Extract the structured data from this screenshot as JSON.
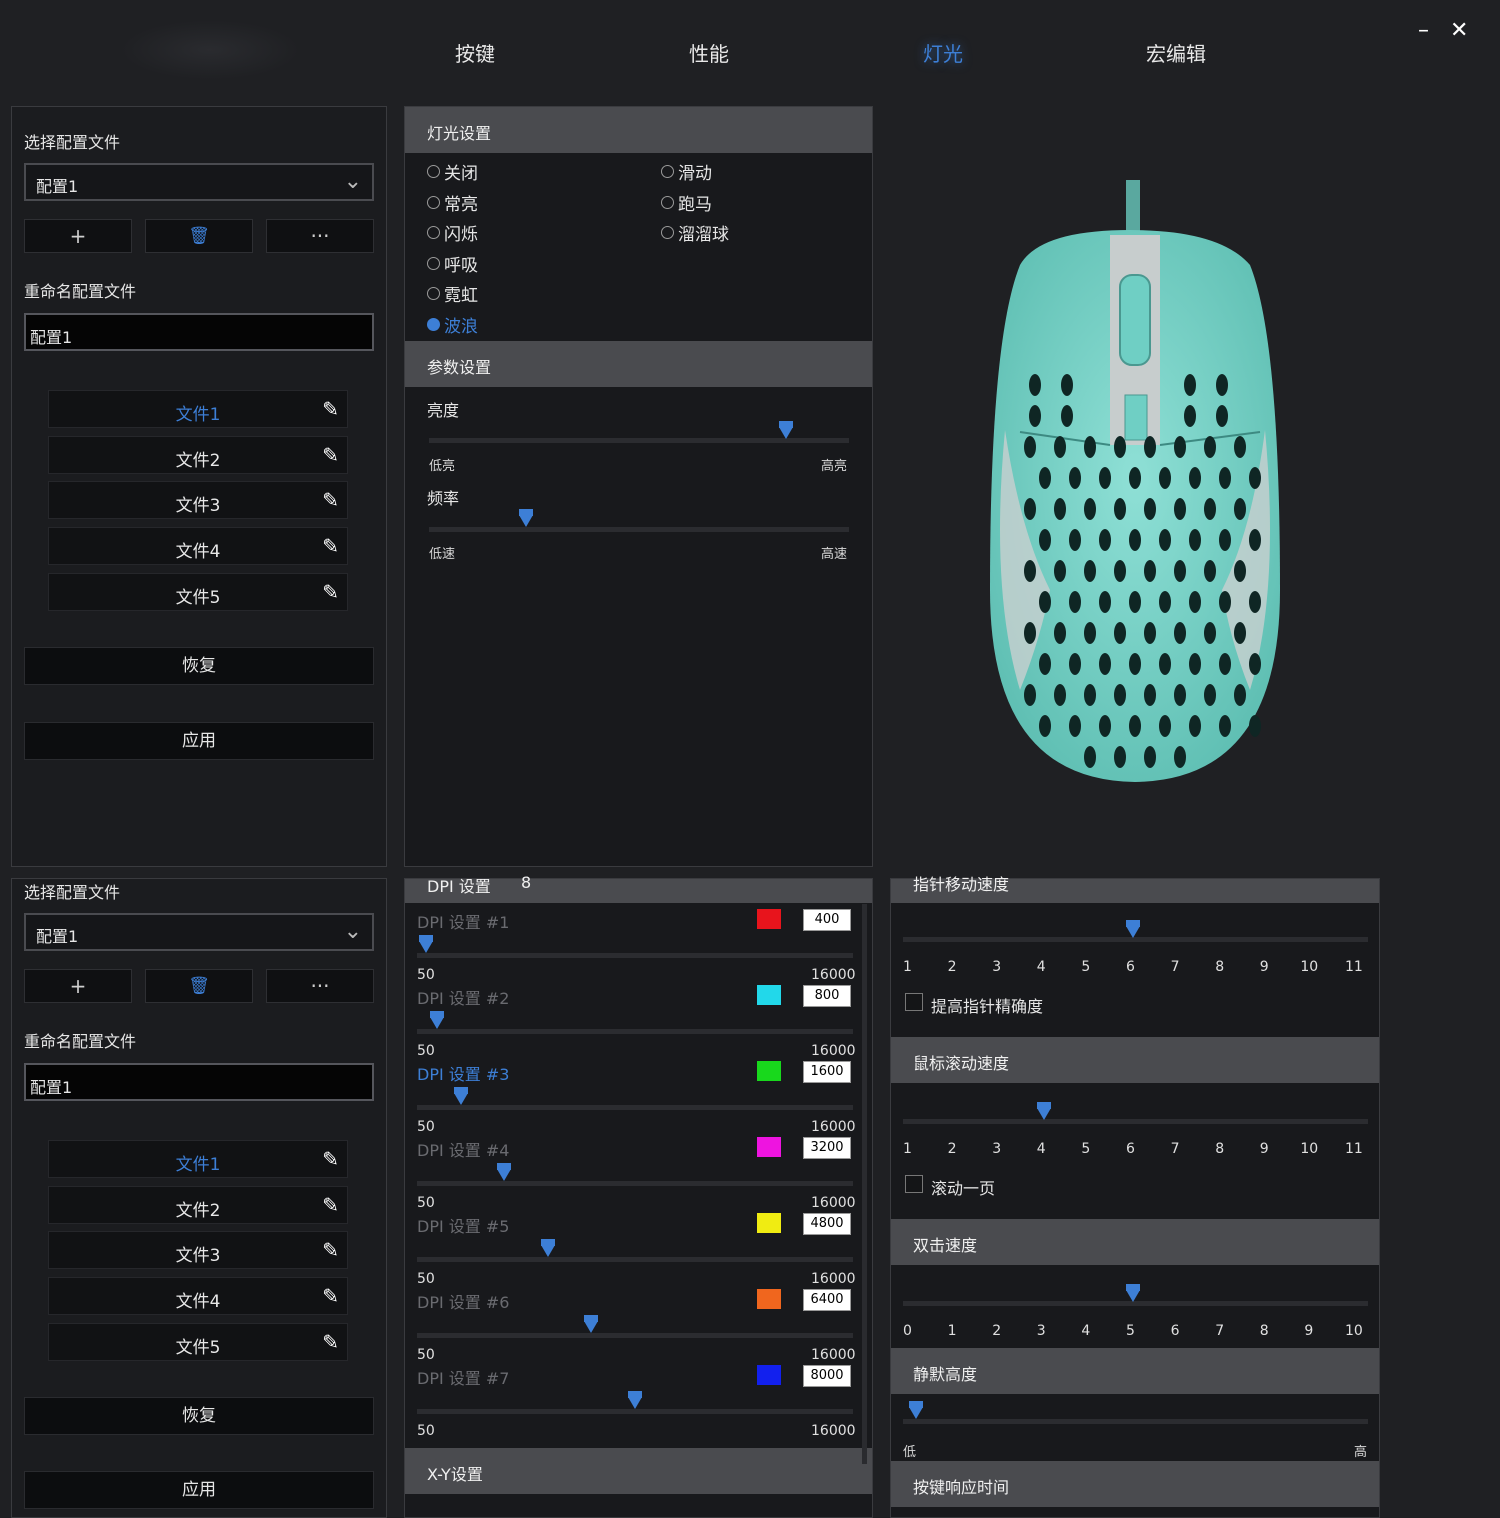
{
  "nav": {
    "tabs": [
      "按键",
      "性能",
      "灯光",
      "宏编辑"
    ],
    "minimize": "–",
    "close": "✕"
  },
  "left": {
    "select_label": "选择配置文件",
    "selected": "配置1",
    "add": "+",
    "delete": "🗑",
    "more": "···",
    "rename_label": "重命名配置文件",
    "rename_value": "配置1",
    "files": [
      "文件1",
      "文件2",
      "文件3",
      "文件4",
      "文件5"
    ],
    "restore": "恢复",
    "apply": "应用"
  },
  "light": {
    "header": "灯光设置",
    "modes_left": [
      "关闭",
      "常亮",
      "闪烁",
      "呼吸",
      "霓虹",
      "波浪"
    ],
    "modes_right": [
      "滑动",
      "跑马",
      "溜溜球"
    ],
    "selected_mode": "波浪",
    "params_header": "参数设置",
    "brightness": {
      "label": "亮度",
      "min": "低亮",
      "max": "高亮",
      "value": 0.85
    },
    "frequency": {
      "label": "频率",
      "min": "低速",
      "max": "高速",
      "value": 0.23
    }
  },
  "dpi": {
    "header_partial": "DPI 设置",
    "count": "8",
    "min": "50",
    "max": "16000",
    "items": [
      {
        "name": "DPI 设置 #1",
        "color": "#e8141c",
        "value": "400",
        "pos": 0.02
      },
      {
        "name": "DPI 设置 #2",
        "color": "#22d8ea",
        "value": "800",
        "pos": 0.047
      },
      {
        "name": "DPI 设置 #3",
        "color": "#18d81c",
        "value": "1600",
        "pos": 0.1
      },
      {
        "name": "DPI 设置 #4",
        "color": "#ee14e0",
        "value": "3200",
        "pos": 0.2
      },
      {
        "name": "DPI 设置 #5",
        "color": "#f0ec12",
        "value": "4800",
        "pos": 0.3
      },
      {
        "name": "DPI 设置 #6",
        "color": "#f0661e",
        "value": "6400",
        "pos": 0.4
      },
      {
        "name": "DPI 设置 #7",
        "color": "#1220ee",
        "value": "8000",
        "pos": 0.5
      }
    ],
    "active_index": 2,
    "xy_header": "X-Y设置"
  },
  "perf": {
    "pointer_header": "指针移动速度",
    "pointer_ticks": [
      "1",
      "2",
      "3",
      "4",
      "5",
      "6",
      "7",
      "8",
      "9",
      "10",
      "11"
    ],
    "pointer_value": 6,
    "precision_label": "提高指针精确度",
    "scroll_header": "鼠标滚动速度",
    "scroll_ticks": [
      "1",
      "2",
      "3",
      "4",
      "5",
      "6",
      "7",
      "8",
      "9",
      "10",
      "11"
    ],
    "scroll_value": 4,
    "scroll_page_label": "滚动一页",
    "dblclick_header": "双击速度",
    "dblclick_ticks": [
      "0",
      "1",
      "2",
      "3",
      "4",
      "5",
      "6",
      "7",
      "8",
      "9",
      "10"
    ],
    "dblclick_value": 5,
    "lod_header": "静默高度",
    "lod_min": "低",
    "lod_max": "高",
    "lod_value": 0,
    "response_header": "按键响应时间"
  }
}
